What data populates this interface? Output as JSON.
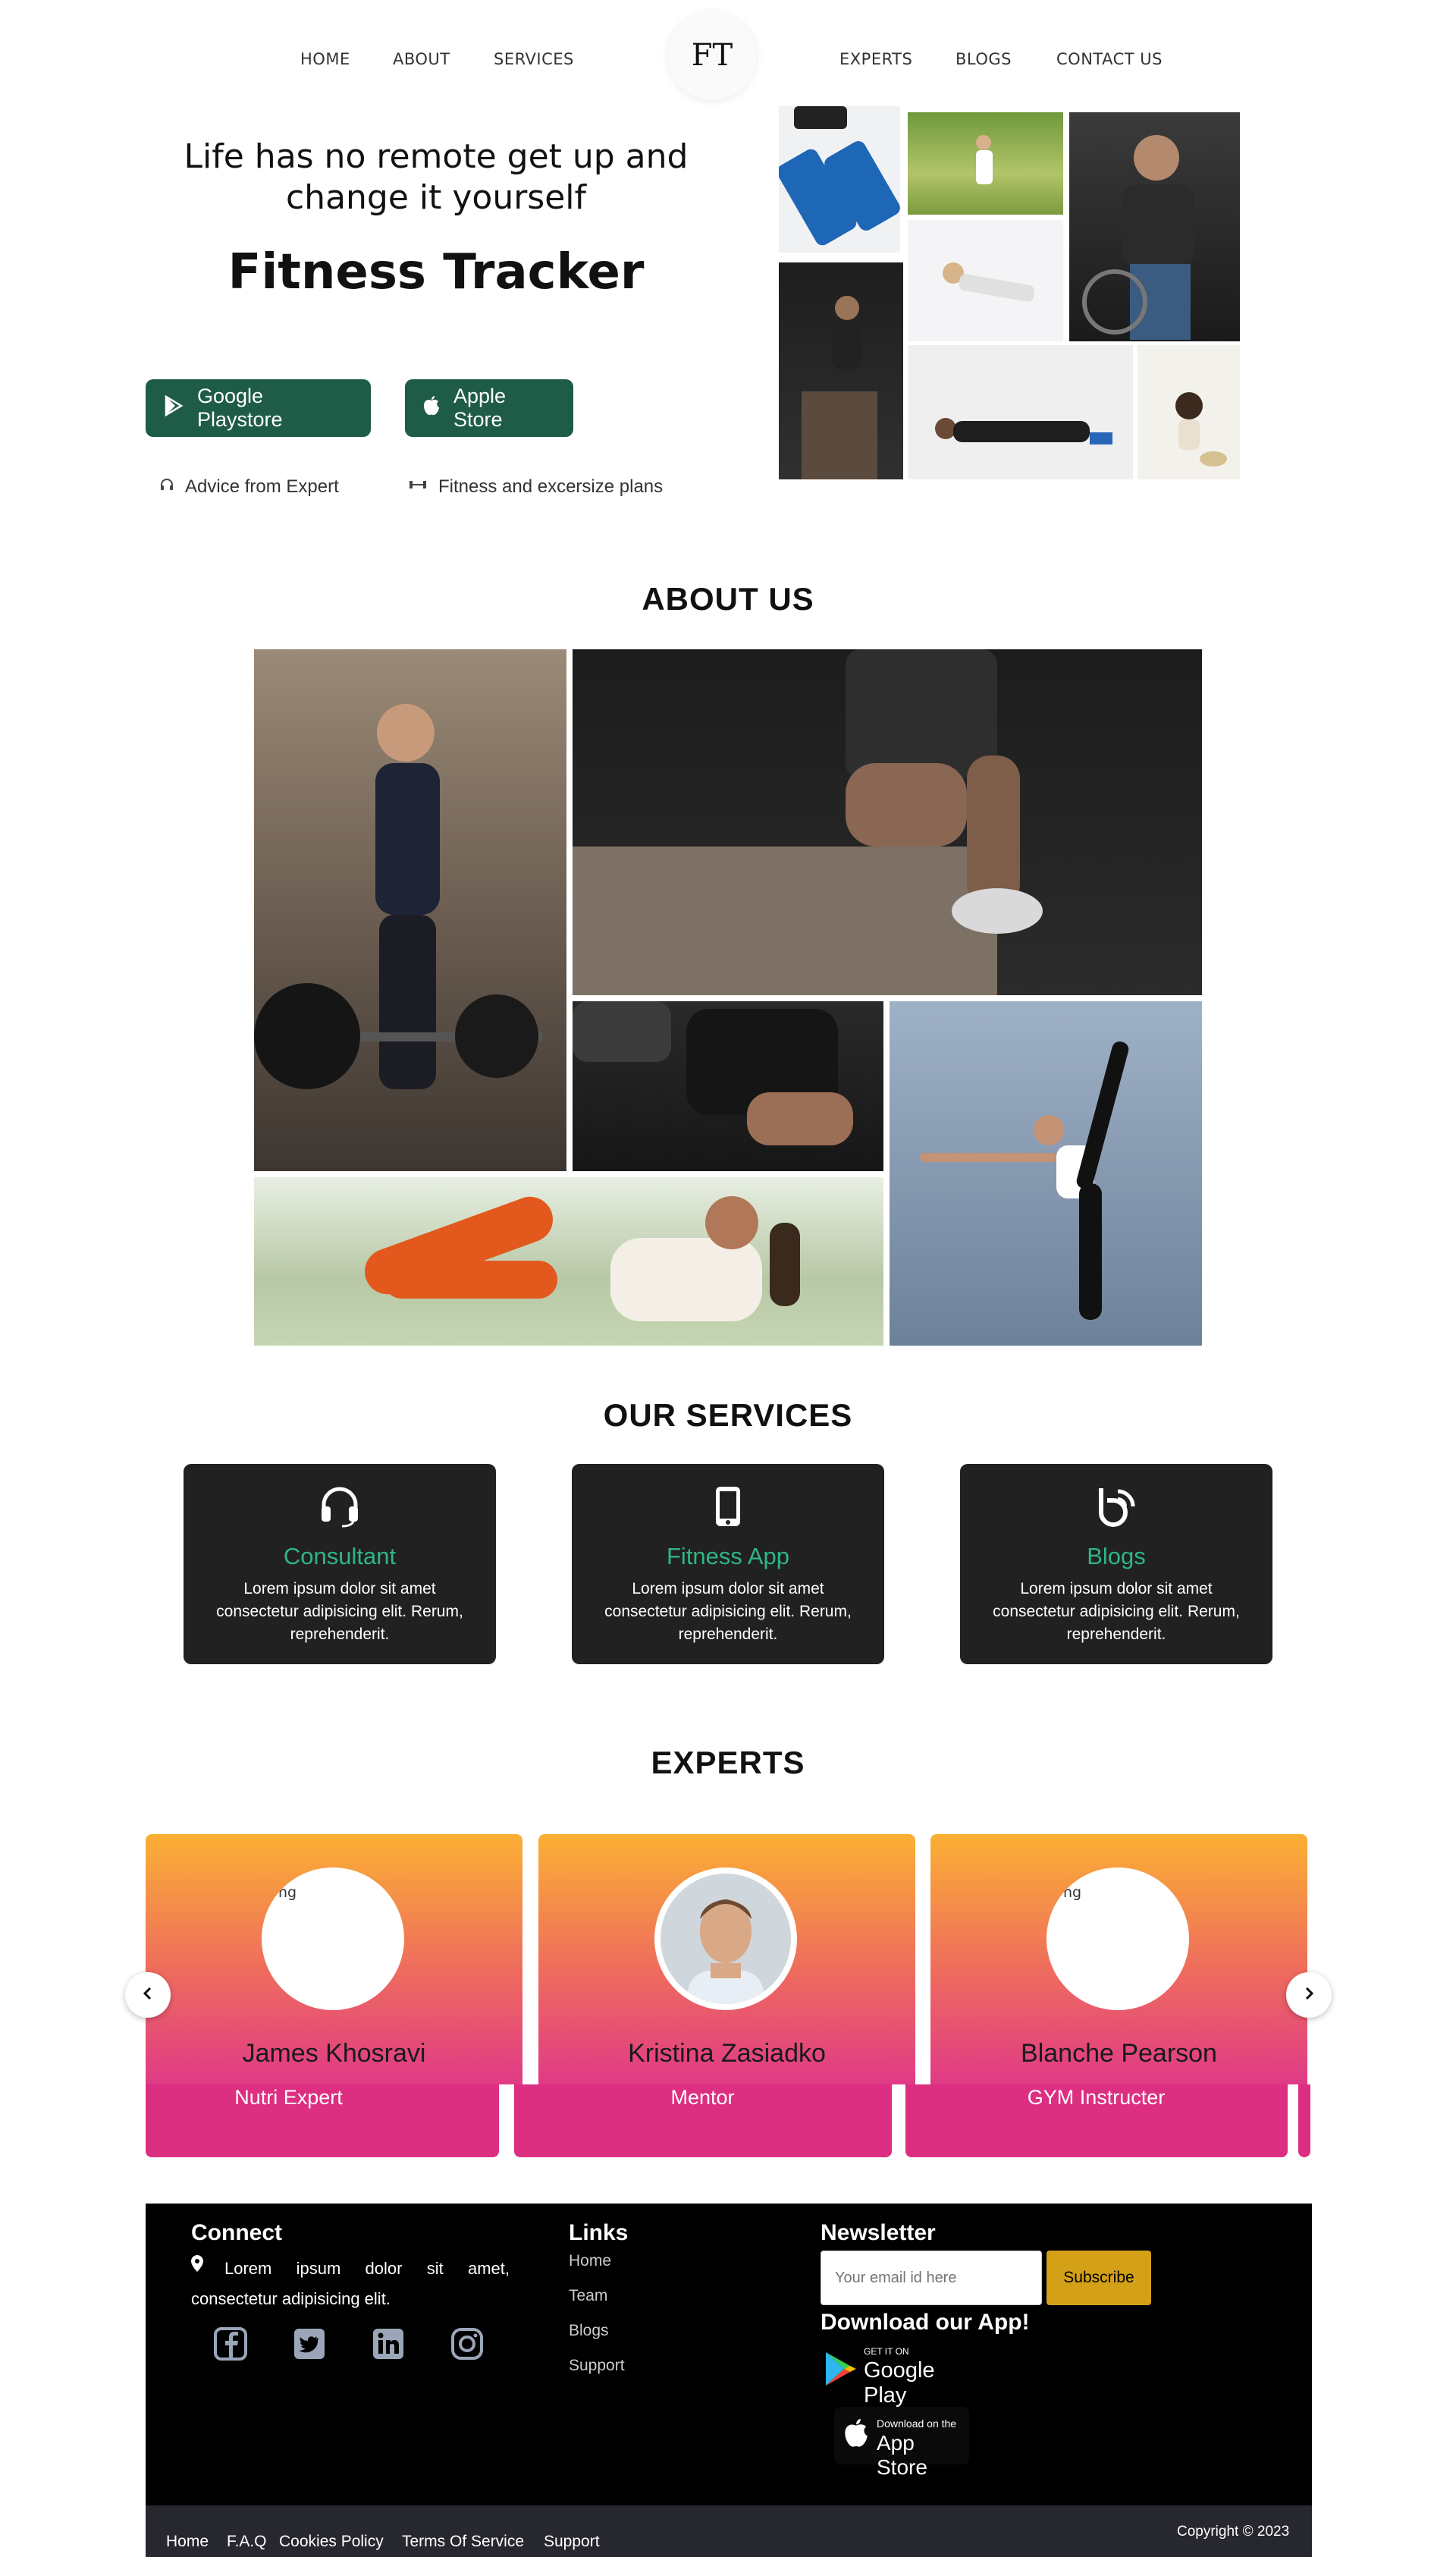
{
  "nav": {
    "left": [
      "HOME",
      "ABOUT",
      "SERVICES"
    ],
    "logo": "FT",
    "right": [
      "EXPERTS",
      "BLOGS",
      "CONTACT US"
    ]
  },
  "hero": {
    "tagline": "Life has no remote get up and change it yourself",
    "title": "Fitness Tracker",
    "buttons": [
      "Google Playstore",
      "Apple Store"
    ],
    "features": [
      "Advice from Expert",
      "Fitness and excersize plans"
    ]
  },
  "about": {
    "title": "ABOUT US"
  },
  "services": {
    "title": "OUR SERVICES",
    "items": [
      {
        "icon": "headset-icon",
        "name": "Consultant",
        "desc": "Lorem ipsum dolor sit amet consectetur adipisicing elit. Rerum, reprehenderit."
      },
      {
        "icon": "mobile-icon",
        "name": "Fitness App",
        "desc": "Lorem ipsum dolor sit amet consectetur adipisicing elit. Rerum, reprehenderit."
      },
      {
        "icon": "blogger-icon",
        "name": "Blogs",
        "desc": "Lorem ipsum dolor sit amet consectetur adipisicing elit. Rerum, reprehenderit."
      }
    ]
  },
  "experts": {
    "title": "EXPERTS",
    "items": [
      {
        "name": "James Khosravi",
        "role": "Nutri Expert",
        "img_alt": "ng"
      },
      {
        "name": "Kristina Zasiadko",
        "role": "Mentor",
        "img_alt": ""
      },
      {
        "name": "Blanche Pearson",
        "role": "GYM Instructer",
        "img_alt": "ng"
      }
    ]
  },
  "footer": {
    "connect_title": "Connect",
    "connect_text": "Lorem ipsum dolor sit amet, consectetur adipisicing elit.",
    "links_title": "Links",
    "links": [
      "Home",
      "Team",
      "Blogs",
      "Support"
    ],
    "newsletter_title": "Newsletter",
    "email_placeholder": "Your email id here",
    "subscribe": "Subscribe",
    "download_title": "Download our App!",
    "gp_small": "GET IT ON",
    "gp_big": "Google Play",
    "as_small": "Download on the",
    "as_big": "App Store"
  },
  "bottom": {
    "links": [
      "Home",
      "F.A.Q",
      "Cookies Policy",
      "Terms Of Service",
      "Support"
    ],
    "copyright": "Copyright © 2023"
  },
  "colors": {
    "accent": "#1f5c48",
    "service_accent": "#2fb584",
    "subscribe": "#d4a017",
    "expert_top": "#fbb034",
    "expert_bottom": "#e03a86"
  }
}
